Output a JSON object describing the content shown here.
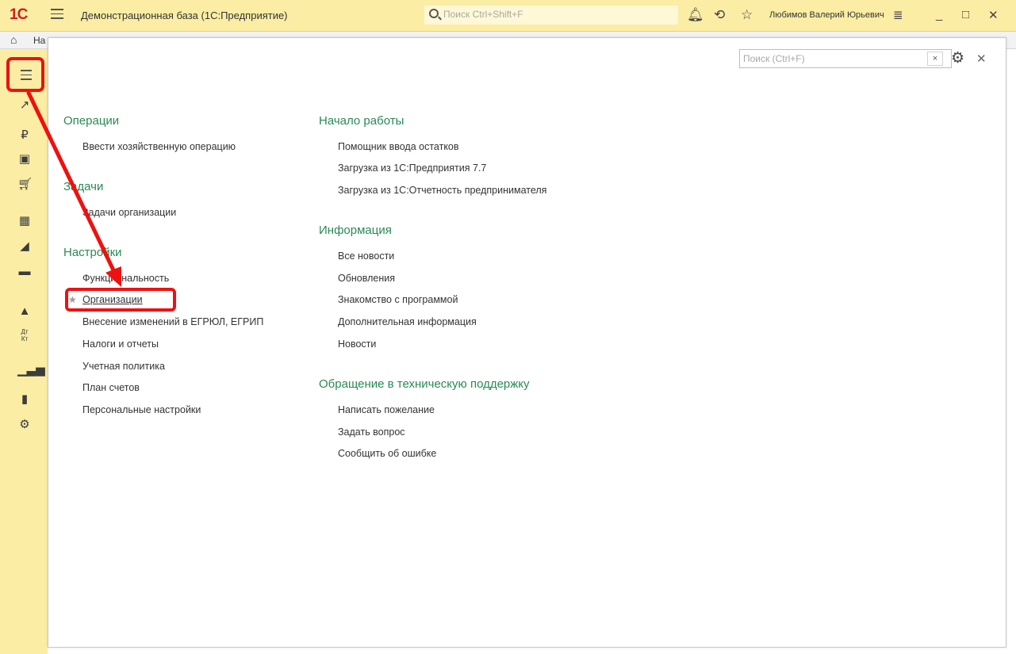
{
  "titlebar": {
    "logo": "1С",
    "app_title": "Демонстрационная база  (1С:Предприятие)",
    "search_placeholder": "Поиск Ctrl+Shift+F",
    "user_name": "Любимов Валерий Юрьевич",
    "icons": [
      "menu-icon",
      "bell-icon",
      "history-icon",
      "star-icon",
      "settings-lines-icon",
      "minimize-icon",
      "maximize-icon",
      "close-icon"
    ]
  },
  "tabrow": {
    "home_tab_text": "На"
  },
  "sidebar": {
    "items": [
      {
        "icon": "menu-icon"
      },
      {
        "icon": "chart-icon"
      },
      {
        "icon": "ruble-icon"
      },
      {
        "icon": "bag-icon"
      },
      {
        "icon": "cart-icon"
      },
      {
        "icon": "warehouse-icon"
      },
      {
        "icon": "factory-icon"
      },
      {
        "icon": "truck-icon"
      },
      {
        "icon": "person-icon"
      },
      {
        "icon": "dt-kt-icon",
        "glyph": "Дт Кт"
      },
      {
        "icon": "reports-icon"
      },
      {
        "icon": "books-icon"
      },
      {
        "icon": "gear-icon"
      }
    ]
  },
  "panel": {
    "search_placeholder": "Поиск (Ctrl+F)",
    "left": {
      "sections": [
        {
          "title": "Операции",
          "items": [
            "Ввести хозяйственную операцию"
          ]
        },
        {
          "title": "Задачи",
          "items": [
            "Задачи организации"
          ]
        },
        {
          "title": "Настройки",
          "items": [
            "Функциональность",
            "Организации",
            "Внесение изменений в ЕГРЮЛ, ЕГРИП",
            "Налоги и отчеты",
            "Учетная политика",
            "План счетов",
            "Персональные настройки"
          ]
        }
      ]
    },
    "right": {
      "sections": [
        {
          "title": "Начало работы",
          "items": [
            "Помощник ввода остатков",
            "Загрузка из 1С:Предприятия 7.7",
            "Загрузка из 1С:Отчетность предпринимателя"
          ]
        },
        {
          "title": "Информация",
          "items": [
            "Все новости",
            "Обновления",
            "Знакомство с программой",
            "Дополнительная информация",
            "Новости"
          ]
        },
        {
          "title": "Обращение в техническую поддержку",
          "items": [
            "Написать пожелание",
            "Задать вопрос",
            "Сообщить об ошибке"
          ]
        }
      ]
    }
  },
  "colors": {
    "toolbar_bg": "#fbeda4",
    "section_title": "#2a8a54",
    "annotation_red": "#ee1111"
  }
}
